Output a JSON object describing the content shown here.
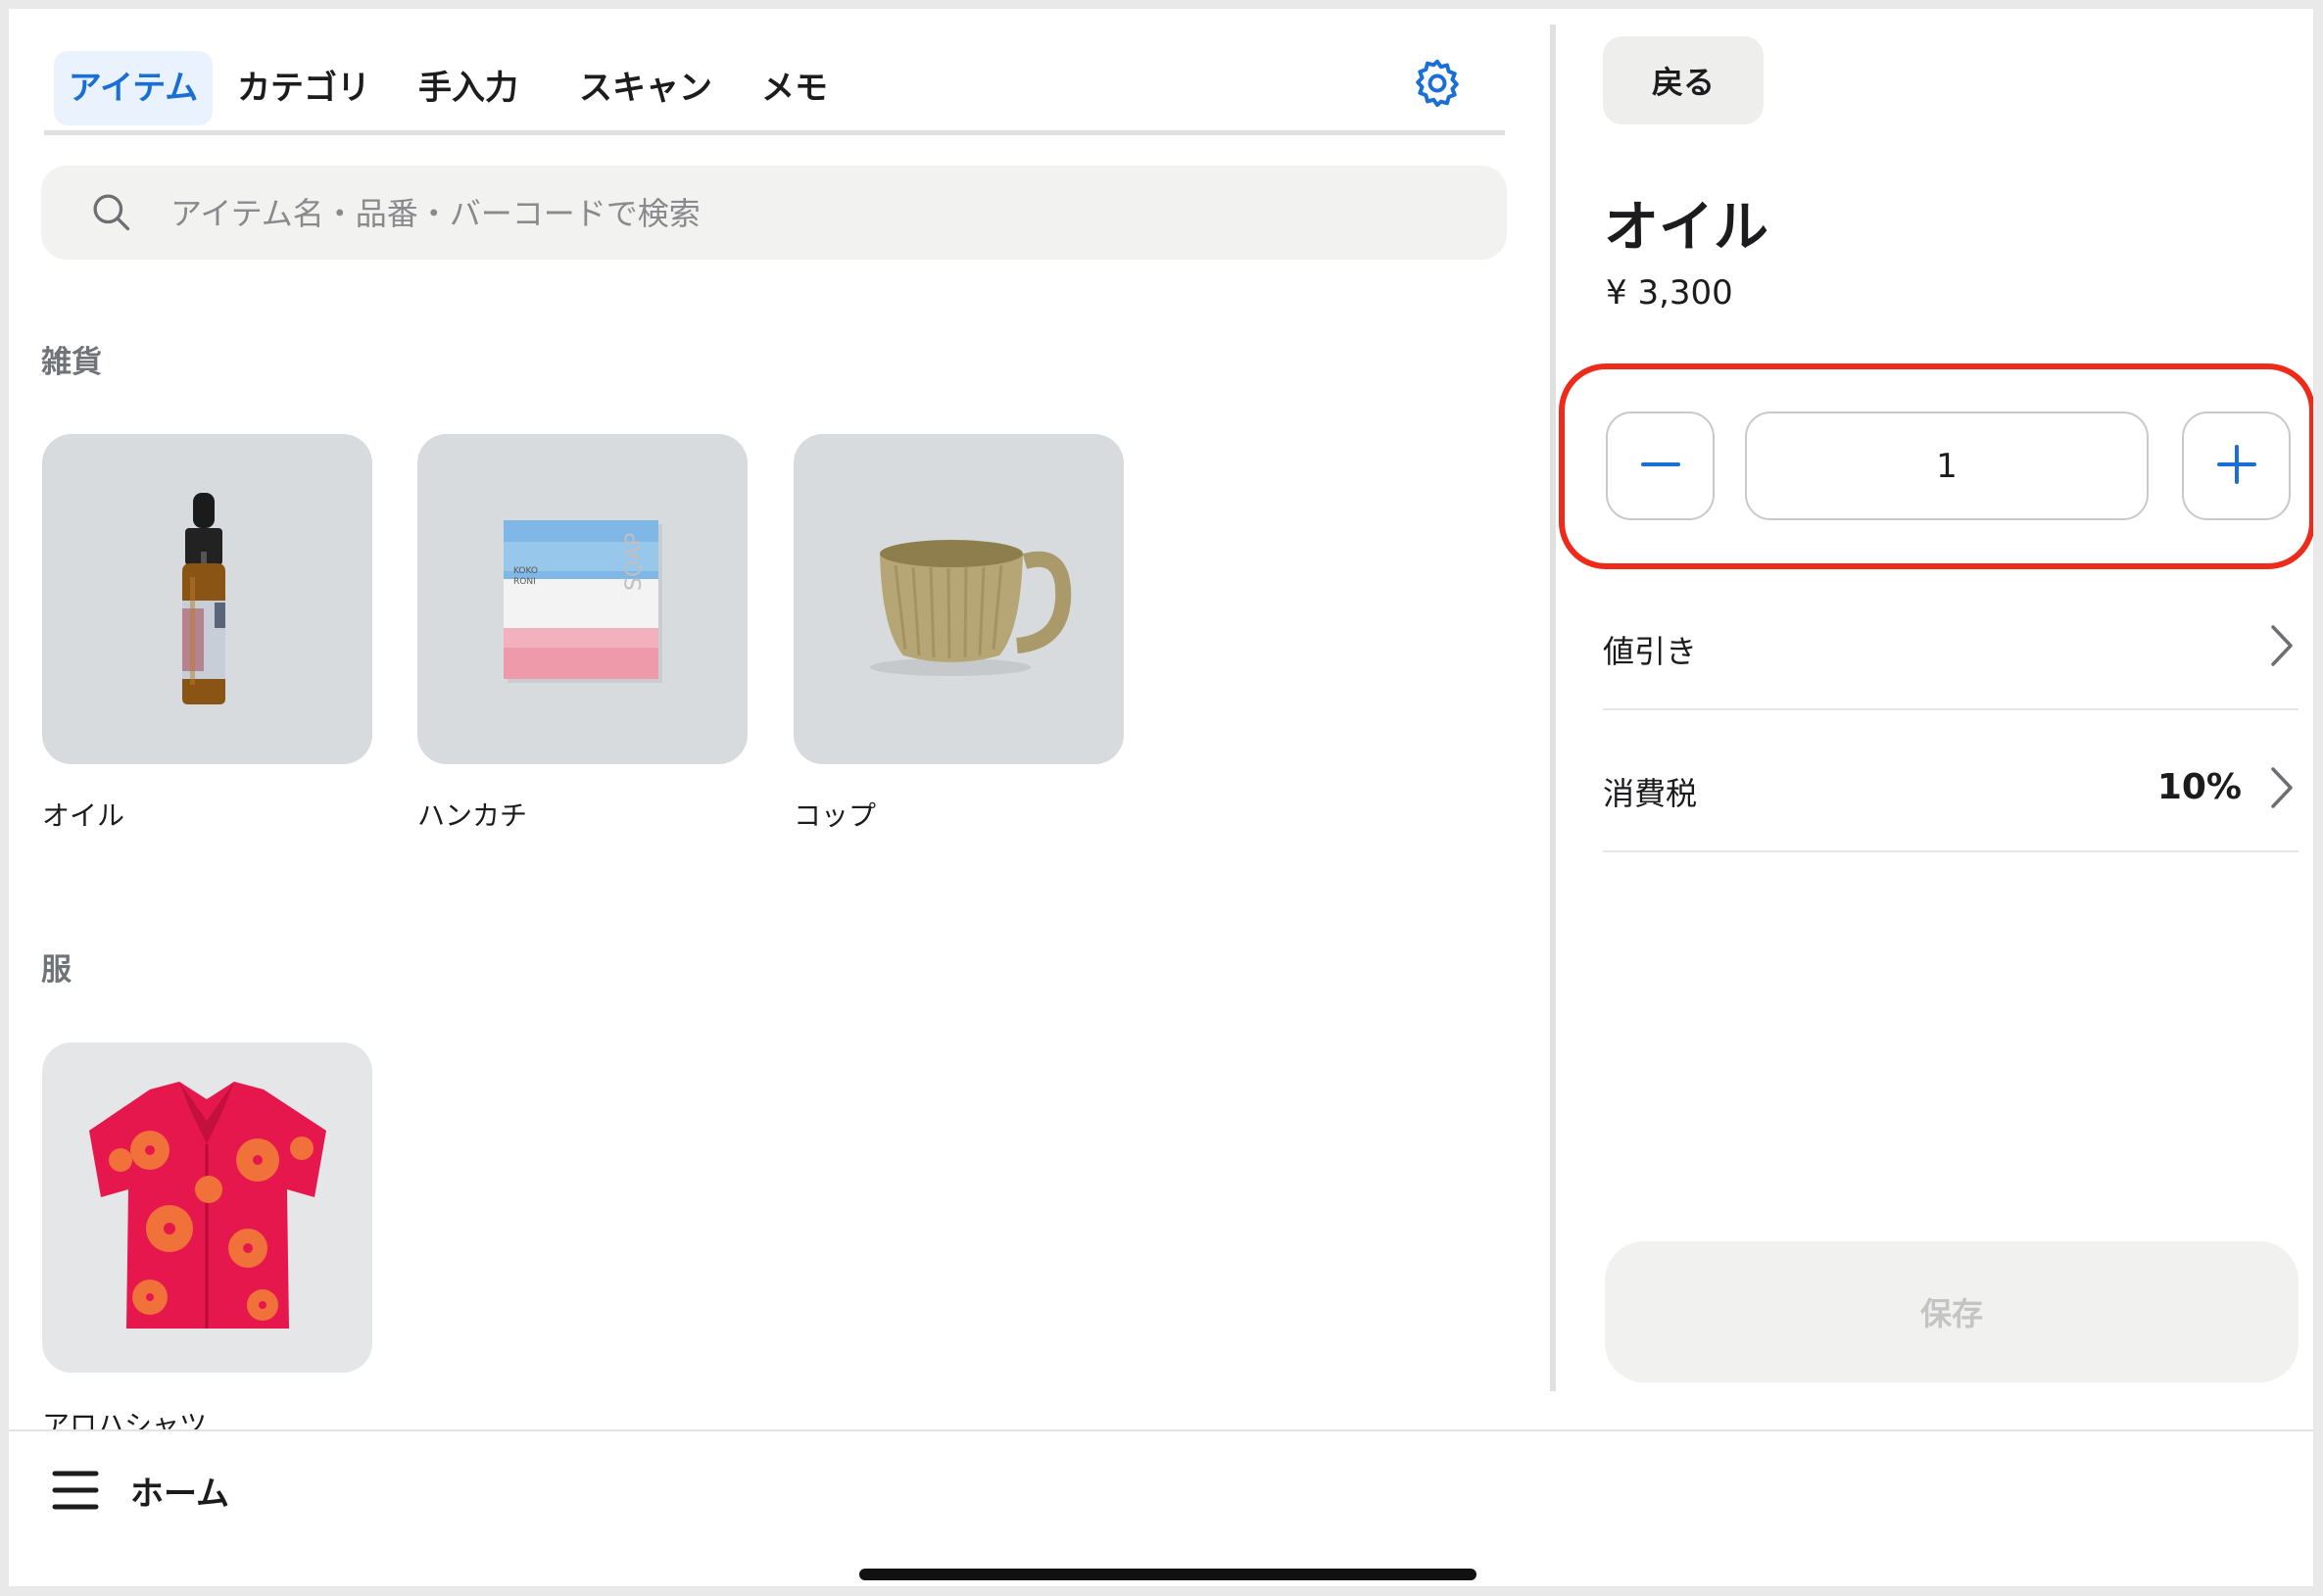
{
  "tabs": [
    {
      "label": "アイテム",
      "active": true
    },
    {
      "label": "カテゴリ",
      "active": false
    },
    {
      "label": "手入力",
      "active": false
    },
    {
      "label": "スキャン",
      "active": false
    },
    {
      "label": "メモ",
      "active": false
    }
  ],
  "search": {
    "placeholder": "アイテム名・品番・バーコードで検索",
    "value": ""
  },
  "sections": [
    {
      "title": "雑貨",
      "items": [
        {
          "name": "オイル",
          "icon": "oil-bottle-image"
        },
        {
          "name": "ハンカチ",
          "icon": "soap-handkerchief-image"
        },
        {
          "name": "コップ",
          "icon": "cup-image"
        }
      ]
    },
    {
      "title": "服",
      "items": [
        {
          "name": "アロハシャツ",
          "icon": "aloha-shirt-image"
        }
      ]
    }
  ],
  "detail": {
    "back_label": "戻る",
    "title": "オイル",
    "price": "¥ 3,300",
    "quantity": "1",
    "discount_label": "値引き",
    "tax_label": "消費税",
    "tax_value": "10%",
    "save_label": "保存"
  },
  "bottom_bar": {
    "title": "ホーム"
  },
  "colors": {
    "accent": "#1a6fd6",
    "highlight": "#ee2a1b",
    "tile_bg": "#d7dbde"
  }
}
